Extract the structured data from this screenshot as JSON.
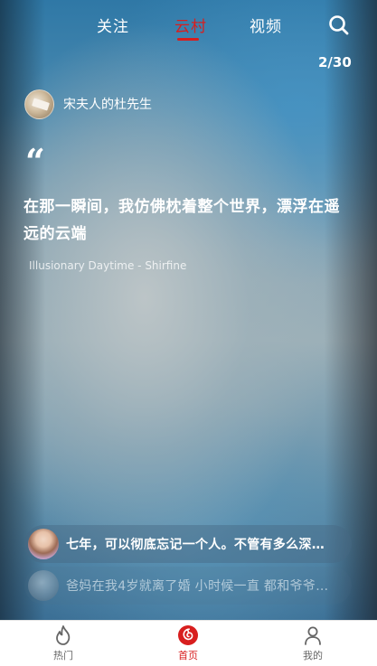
{
  "nav": {
    "tabs": [
      {
        "label": "关注",
        "active": false
      },
      {
        "label": "云村",
        "active": true
      },
      {
        "label": "视频",
        "active": false
      }
    ],
    "search_icon": "search-icon"
  },
  "counter": "2/30",
  "post": {
    "user_name": "宋夫人的杜先生",
    "quote_mark": "“",
    "lyric": "在那一瞬间，我仿佛枕着整个世界，漂浮在遥远的云端",
    "song": "Illusionary Daytime - Shirfine"
  },
  "comments": [
    {
      "text": "七年，可以彻底忘记一个人。不管有多么深…"
    },
    {
      "text": "爸妈在我4岁就离了婚 小时候一直 都和爷爷…"
    }
  ],
  "bottom_bar": {
    "items": [
      {
        "label": "热门",
        "icon": "flame-icon",
        "active": false
      },
      {
        "label": "首页",
        "icon": "netease-music-icon",
        "active": true
      },
      {
        "label": "我的",
        "icon": "person-icon",
        "active": false
      }
    ]
  },
  "colors": {
    "accent": "#d81e1e",
    "text_light": "#ffffff",
    "tab_inactive_label": "#666666"
  }
}
